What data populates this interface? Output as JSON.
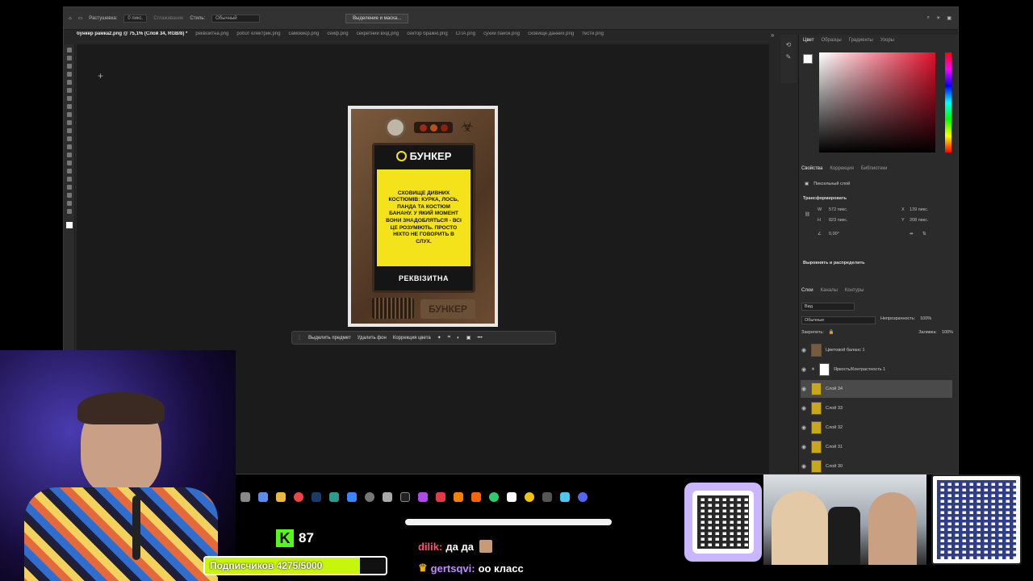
{
  "toolbar": {
    "feather_label": "Растушевка:",
    "feather_value": "0 пикс.",
    "antialias_label": "Сглаживание",
    "style_label": "Стиль:",
    "style_value": "Обычный",
    "select_mask_btn": "Выделение и маска..."
  },
  "tabs": [
    "бункер рамка2.png @ 75,1% (Слой 34, RGB/8) *",
    "реквізитна.png",
    "робот електрик.png",
    "самокиєр.png",
    "сейф.png",
    "секретний вхід.png",
    "сектор бражні.png",
    "СПА.png",
    "сухий пайок.png",
    "сховище данних.png",
    "тести.png"
  ],
  "card": {
    "title": "БУНКЕР",
    "body": "СХОВИЩЕ ДИВНИХ КОСТЮМІВ: КУРКА, ЛОСЬ, ПАНДА ТА КОСТЮМ БАНАНУ. У ЯКИЙ МОМЕНТ ВОНИ ЗНАДОБЛЯТЬСЯ - ВСІ ЦЕ РОЗУМІЮТЬ. ПРОСТО НІХТО НЕ ГОВОРИТЬ В СЛУХ.",
    "footer": "РЕКВІЗИТНА",
    "plate": "БУНКЕР"
  },
  "contextbar": {
    "select_subject": "Выделить предмет",
    "remove_bg": "Удалить фон",
    "color_correction": "Коррекция цвета"
  },
  "color_panel": {
    "tabs": [
      "Цвет",
      "Образцы",
      "Градиенты",
      "Узоры"
    ]
  },
  "properties": {
    "tabs": [
      "Свойства",
      "Коррекция",
      "Библиотеки"
    ],
    "kind": "Пиксельный слой",
    "section": "Трансформировать",
    "w": "572 пикс.",
    "h": "823 пикс.",
    "x": "139 пикс.",
    "y": "208 пикс.",
    "angle": "0,00°",
    "align": "Выровнять и распределить"
  },
  "layers_panel": {
    "tabs": [
      "Слои",
      "Каналы",
      "Контуры"
    ],
    "search": "Вид",
    "blend": "Обычные",
    "opacity_label": "Непрозрачность:",
    "opacity": "100%",
    "lock_label": "Закрепить:",
    "fill_label": "Заливка:",
    "fill": "100%",
    "layers": [
      "Цветовой баланс 1",
      "Яркость/Контрастность 1",
      "Слой 34",
      "Слой 33",
      "Слой 32",
      "Слой 31",
      "Слой 30"
    ],
    "selected": "Слой 34"
  },
  "stream": {
    "points": "87",
    "subscribers": "Подписчиков 4275/5000",
    "subs_progress": 0.855,
    "chat": [
      {
        "user": "dilik:",
        "text": "да да"
      },
      {
        "user": "gertsqvi:",
        "text": "оо класс"
      }
    ]
  },
  "colors": {
    "accent": "#f4e21a",
    "progress": "#c7f50b",
    "chat_user1": "#ff4d6d",
    "chat_user2": "#c18cff"
  }
}
